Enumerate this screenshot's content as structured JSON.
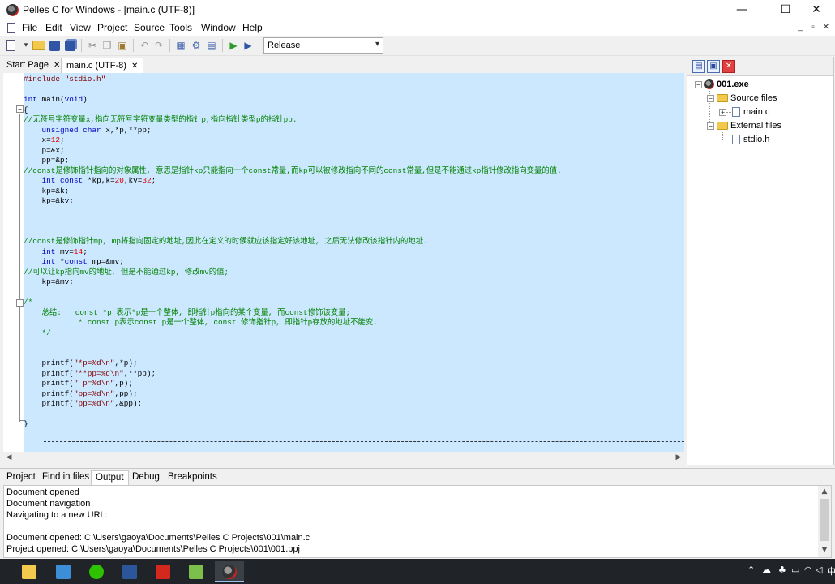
{
  "window": {
    "title": "Pelles C for Windows - [main.c (UTF-8)]",
    "minimize_glyph": "—",
    "maximize_glyph": "☐",
    "close_glyph": "✕"
  },
  "menu": {
    "items": [
      "File",
      "Edit",
      "View",
      "Project",
      "Source",
      "Tools",
      "Window",
      "Help"
    ],
    "mdi_minimize": "_",
    "mdi_restore": "▫",
    "mdi_close": "✕"
  },
  "toolbar": {
    "configuration": "Release",
    "icons": [
      "new-file-icon",
      "open-folder-icon",
      "save-icon",
      "save-all-icon",
      "cut-icon",
      "copy-icon",
      "paste-icon",
      "undo-icon",
      "redo-icon",
      "compile-icon",
      "build-icon",
      "execute-icon",
      "go-icon",
      "debug-icon"
    ]
  },
  "editor_tabs": [
    {
      "label": "Start Page",
      "active": false
    },
    {
      "label": "main.c (UTF-8)",
      "active": true
    }
  ],
  "code_lines": [
    [
      {
        "t": "#include ",
        "c": "pp"
      },
      {
        "t": "\"stdio.h\"",
        "c": "st"
      }
    ],
    [],
    [
      {
        "t": "int",
        "c": "kw"
      },
      {
        "t": " main(",
        "c": ""
      },
      {
        "t": "void",
        "c": "kw"
      },
      {
        "t": ")",
        "c": ""
      }
    ],
    [
      {
        "t": "{",
        "c": ""
      }
    ],
    [
      {
        "t": "//无符号字符变量x,指向无符号字符变量类型的指针p,指向指针类型p的指针pp.",
        "c": "cm"
      }
    ],
    [
      {
        "t": "    ",
        "c": ""
      },
      {
        "t": "unsigned",
        "c": "kw"
      },
      {
        "t": " ",
        "c": ""
      },
      {
        "t": "char",
        "c": "kw"
      },
      {
        "t": " x,*p,**pp;",
        "c": ""
      }
    ],
    [
      {
        "t": "    x=",
        "c": ""
      },
      {
        "t": "12",
        "c": "nm"
      },
      {
        "t": ";",
        "c": ""
      }
    ],
    [
      {
        "t": "    p=&x;",
        "c": ""
      }
    ],
    [
      {
        "t": "    pp=&p;",
        "c": ""
      }
    ],
    [
      {
        "t": "//const是修饰指针指向的对象属性, 意思是指针kp只能指向一个const常量,而kp可以被修改指向不同的const常量,但是不能通过kp指针修改指向变量的值.",
        "c": "cm"
      }
    ],
    [
      {
        "t": "    ",
        "c": ""
      },
      {
        "t": "int",
        "c": "kw"
      },
      {
        "t": " ",
        "c": ""
      },
      {
        "t": "const",
        "c": "kw"
      },
      {
        "t": " *kp,k=",
        "c": ""
      },
      {
        "t": "20",
        "c": "nm"
      },
      {
        "t": ",kv=",
        "c": ""
      },
      {
        "t": "32",
        "c": "nm"
      },
      {
        "t": ";",
        "c": ""
      }
    ],
    [
      {
        "t": "    kp=&k;",
        "c": ""
      }
    ],
    [
      {
        "t": "    kp=&kv;",
        "c": ""
      }
    ],
    [],
    [],
    [],
    [
      {
        "t": "//const是修饰指针mp, mp将指向固定的地址,因此在定义的时候就应该指定好该地址, 之后无法修改该指针内的地址.",
        "c": "cm"
      }
    ],
    [
      {
        "t": "    ",
        "c": ""
      },
      {
        "t": "int",
        "c": "kw"
      },
      {
        "t": " mv=",
        "c": ""
      },
      {
        "t": "14",
        "c": "nm"
      },
      {
        "t": ";",
        "c": ""
      }
    ],
    [
      {
        "t": "    ",
        "c": ""
      },
      {
        "t": "int",
        "c": "kw"
      },
      {
        "t": " *",
        "c": ""
      },
      {
        "t": "const",
        "c": "kw"
      },
      {
        "t": " mp=&mv;",
        "c": ""
      }
    ],
    [
      {
        "t": "//可以让kp指向mv的地址, 但是不能通过kp, 修改mv的值;",
        "c": "cm"
      }
    ],
    [
      {
        "t": "    kp=&mv;",
        "c": ""
      }
    ],
    [],
    [
      {
        "t": "/*",
        "c": "cm"
      }
    ],
    [
      {
        "t": "    总结:   const *p 表示*p是一个整体, 即指针p指向的某个变量, 而const修饰该变量;",
        "c": "cm"
      }
    ],
    [
      {
        "t": "            * const p表示const p是一个整体, const 修饰指针p, 即指针p存放的地址不能变.",
        "c": "cm"
      }
    ],
    [
      {
        "t": "    */",
        "c": "cm"
      }
    ],
    [],
    [],
    [
      {
        "t": "    printf(",
        "c": ""
      },
      {
        "t": "\"*p=%d\\n\"",
        "c": "st"
      },
      {
        "t": ",*p);",
        "c": ""
      }
    ],
    [
      {
        "t": "    printf(",
        "c": ""
      },
      {
        "t": "\"**pp=%d\\n\"",
        "c": "st"
      },
      {
        "t": ",**pp);",
        "c": ""
      }
    ],
    [
      {
        "t": "    printf(",
        "c": ""
      },
      {
        "t": "\" p=%d\\n\"",
        "c": "st"
      },
      {
        "t": ",p);",
        "c": ""
      }
    ],
    [
      {
        "t": "    printf(",
        "c": ""
      },
      {
        "t": "\"pp=%d\\n\"",
        "c": "st"
      },
      {
        "t": ",pp);",
        "c": ""
      }
    ],
    [
      {
        "t": "    printf(",
        "c": ""
      },
      {
        "t": "\"pp=%d\\n\"",
        "c": "st"
      },
      {
        "t": ",&pp);",
        "c": ""
      }
    ],
    [],
    [
      {
        "t": "}",
        "c": ""
      }
    ]
  ],
  "project_tree": {
    "root": "001.exe",
    "source_folder": "Source files",
    "source_file": "main.c",
    "external_folder": "External files",
    "external_file": "stdio.h"
  },
  "bottom_tabs": [
    {
      "label": "Project",
      "active": false
    },
    {
      "label": "Find in files",
      "active": false
    },
    {
      "label": "Output",
      "active": true
    },
    {
      "label": "Debug",
      "active": false
    },
    {
      "label": "Breakpoints",
      "active": false
    }
  ],
  "output_lines": [
    "Document opened",
    "Document navigation",
    "Navigating to a new URL:",
    "",
    "Document opened: C:\\Users\\gaoya\\Documents\\Pelles C Projects\\001\\main.c",
    "Project opened: C:\\Users\\gaoya\\Documents\\Pelles C Projects\\001\\001.ppj"
  ],
  "taskbar": {
    "apps": [
      "file-explorer",
      "control-panel",
      "wechat",
      "word",
      "acrobat",
      "notepad",
      "pelles-c"
    ],
    "tray_text": "中"
  },
  "colors": {
    "selection": "#cce8ff",
    "keyword": "#0000c0",
    "comment": "#008000",
    "number": "#e00000",
    "string": "#800000"
  }
}
